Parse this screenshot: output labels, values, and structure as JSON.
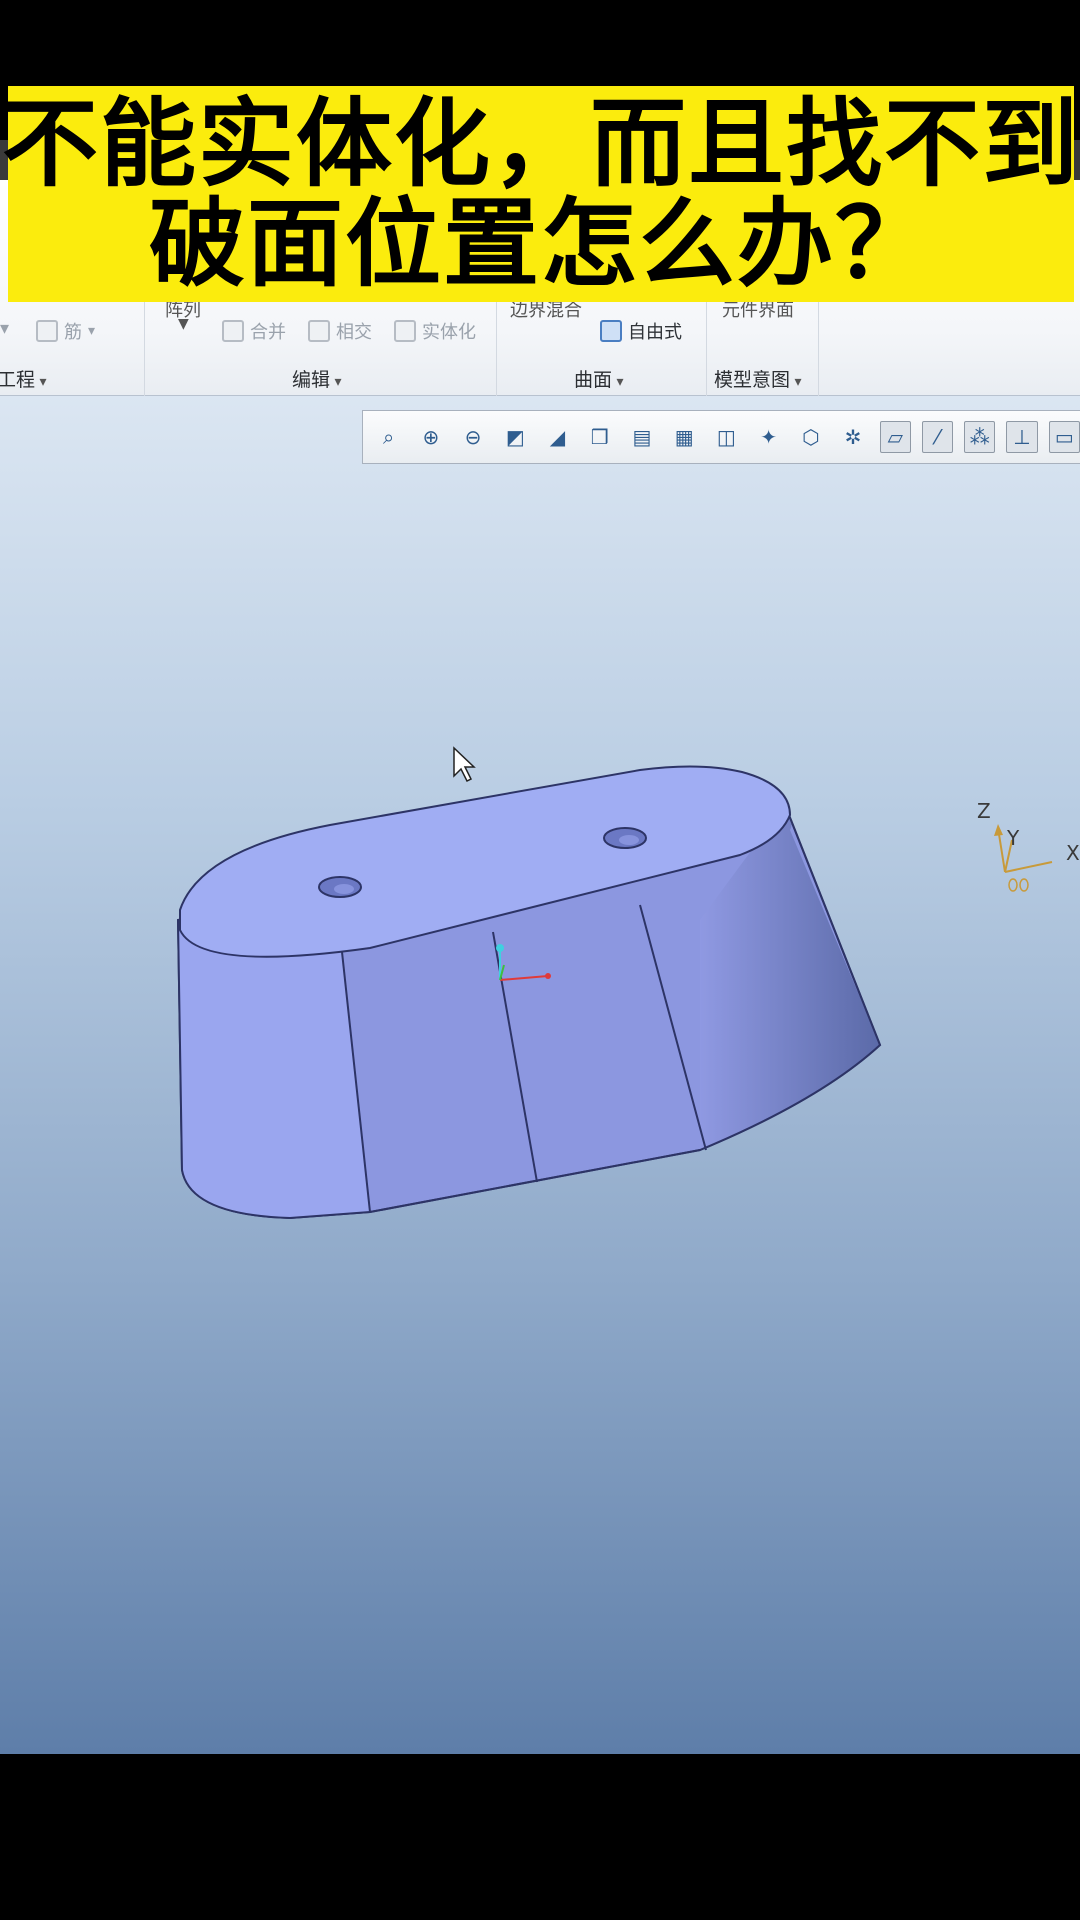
{
  "banner": {
    "line1": "不能实体化，而且找不到",
    "line2": "破面位置怎么办？",
    "bg_color": "#fbec0d"
  },
  "ribbon": {
    "cut_top_left": "阵列",
    "cut_top_mid": "边界混合",
    "cut_top_right": "元件界面",
    "items": {
      "rib": "筋",
      "merge": "合并",
      "intersect": "相交",
      "solidify": "实体化",
      "freestyle": "自由式"
    },
    "groups": {
      "engineering": "工程",
      "edit": "编辑",
      "surface": "曲面",
      "model_intent": "模型意图"
    }
  },
  "view_toolbar": {
    "icons": [
      "refit-icon",
      "zoom-in-icon",
      "zoom-out-icon",
      "repaint-icon",
      "shading-icon",
      "display-style-icon",
      "saved-views-icon",
      "view-manager-icon",
      "perspective-icon",
      "spin-center-icon",
      "datum-display-icon",
      "annotation-icon",
      "plane-display-icon",
      "axis-display-icon",
      "point-display-icon",
      "csys-display-icon",
      "more-icon"
    ]
  },
  "viewport": {
    "axis_labels": {
      "z": "Z",
      "y": "Y",
      "x": "X"
    },
    "model_color": "#9aa7ee"
  }
}
